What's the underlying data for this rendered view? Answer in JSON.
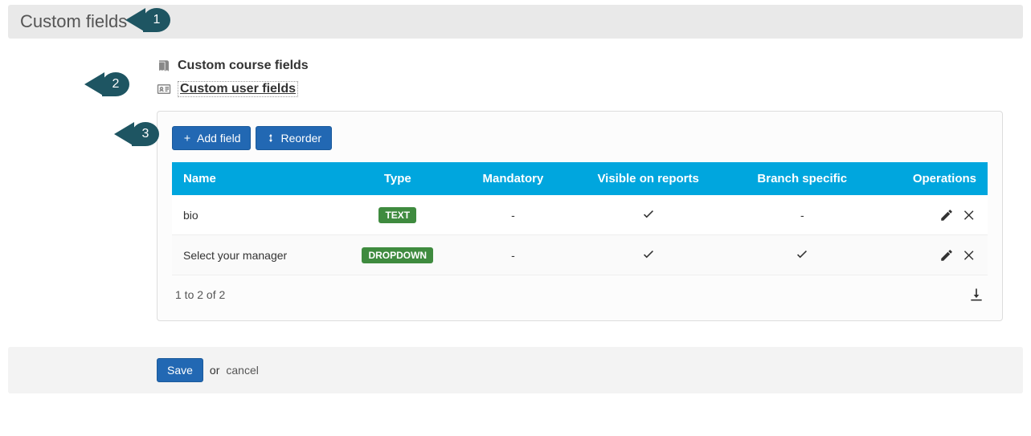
{
  "header": {
    "title": "Custom fields"
  },
  "callouts": {
    "c1": "1",
    "c2": "2",
    "c3": "3"
  },
  "tabs": {
    "course": {
      "label": "Custom course fields"
    },
    "user": {
      "label": "Custom user fields"
    }
  },
  "toolbar": {
    "add_label": "Add field",
    "reorder_label": "Reorder"
  },
  "table": {
    "headers": {
      "name": "Name",
      "type": "Type",
      "mandatory": "Mandatory",
      "visible": "Visible on reports",
      "branch": "Branch specific",
      "ops": "Operations"
    },
    "rows": [
      {
        "name": "bio",
        "type_badge": "TEXT",
        "mandatory": "-",
        "visible": true,
        "branch": "-"
      },
      {
        "name": "Select your manager",
        "type_badge": "DROPDOWN",
        "mandatory": "-",
        "visible": true,
        "branch": true
      }
    ],
    "pagination": "1 to 2 of 2"
  },
  "footer": {
    "save_label": "Save",
    "or_text": "or",
    "cancel_label": "cancel"
  }
}
